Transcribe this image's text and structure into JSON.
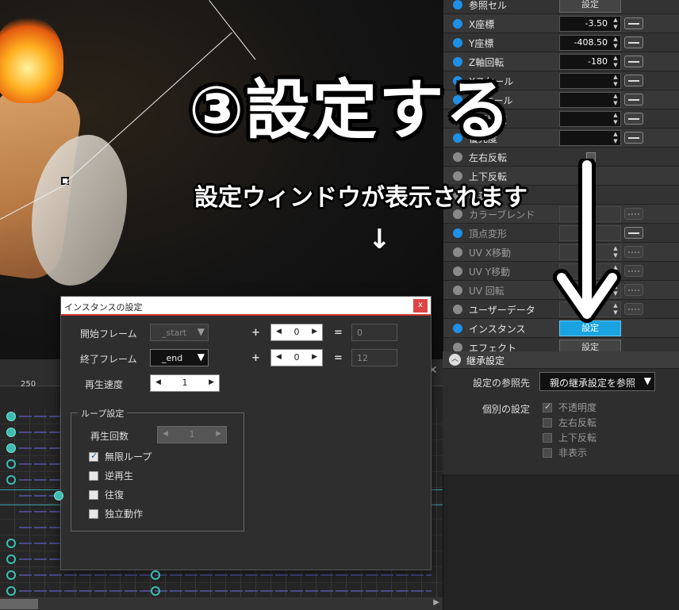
{
  "overlay": {
    "title": "③設定する",
    "subtitle": "設定ウィンドウが表示されます",
    "small_arrow": "↓"
  },
  "props": {
    "rows": [
      {
        "label": "参照セル",
        "type": "button",
        "value": "設定",
        "dot": "blue"
      },
      {
        "label": "X座標",
        "type": "field",
        "value": "-3.50",
        "dot": "blue"
      },
      {
        "label": "Y座標",
        "type": "field",
        "value": "-408.50",
        "dot": "blue"
      },
      {
        "label": "Z軸回転",
        "type": "field",
        "value": "-180",
        "dot": "blue"
      },
      {
        "label": "Xスケール",
        "type": "field",
        "value": "",
        "dot": "blue"
      },
      {
        "label": "Yスケール",
        "type": "field",
        "value": "",
        "dot": "blue"
      },
      {
        "label": "不透明度",
        "type": "field",
        "value": "",
        "dot": "blue"
      },
      {
        "label": "優先度",
        "type": "field",
        "value": "",
        "dot": "blue"
      },
      {
        "label": "左右反転",
        "type": "check",
        "value": "",
        "dot": "gray"
      },
      {
        "label": "上下反転",
        "type": "check",
        "value": "",
        "dot": "gray"
      },
      {
        "label": "非表示",
        "type": "none",
        "value": "",
        "dot": "gray"
      },
      {
        "label": "カラーブレンド",
        "type": "empty",
        "value": "",
        "dot": "gray"
      },
      {
        "label": "頂点変形",
        "type": "empty",
        "value": "",
        "dot": "blue"
      },
      {
        "label": "UV X移動",
        "type": "empty",
        "value": "",
        "dot": "gray"
      },
      {
        "label": "UV Y移動",
        "type": "empty",
        "value": "",
        "dot": "gray"
      },
      {
        "label": "UV 回転",
        "type": "empty",
        "value": "",
        "dot": "gray"
      },
      {
        "label": "ユーザーデータ",
        "type": "empty",
        "value": "",
        "dot": "gray"
      },
      {
        "label": "インスタンス",
        "type": "button-active",
        "value": "設定",
        "dot": "blue"
      },
      {
        "label": "エフェクト",
        "type": "button",
        "value": "設定",
        "dot": "gray"
      }
    ]
  },
  "inherit": {
    "section_title": "継承設定",
    "ref_label": "設定の参照先",
    "ref_value": "親の継承設定を参照",
    "individual_label": "個別の設定",
    "options": [
      {
        "label": "不透明度",
        "checked": true
      },
      {
        "label": "左右反転",
        "checked": false
      },
      {
        "label": "上下反転",
        "checked": false
      },
      {
        "label": "非表示",
        "checked": false
      }
    ]
  },
  "timeline": {
    "frame_label": "250"
  },
  "dialog": {
    "title": "インスタンスの設定",
    "close": "x",
    "start_label": "開始フレーム",
    "start_select": "_start",
    "start_offset": "0",
    "start_result": "0",
    "end_label": "終了フレーム",
    "end_select": "_end",
    "end_offset": "0",
    "end_result": "12",
    "speed_label": "再生速度",
    "speed_value": "1",
    "plus": "+",
    "equals": "=",
    "loop_group": "ループ設定",
    "loop_count_label": "再生回数",
    "loop_count_value": "1",
    "options": [
      {
        "label": "無限ループ",
        "checked": true
      },
      {
        "label": "逆再生",
        "checked": false
      },
      {
        "label": "往復",
        "checked": false
      },
      {
        "label": "独立動作",
        "checked": false
      }
    ]
  }
}
